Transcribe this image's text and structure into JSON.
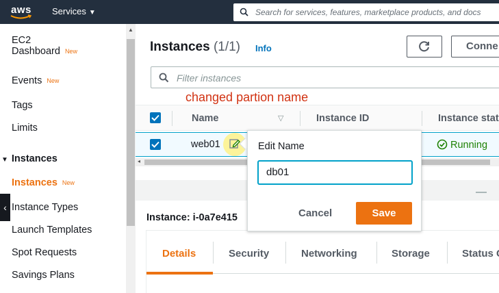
{
  "topbar": {
    "logo_text": "aws",
    "services_label": "Services",
    "search_placeholder": "Search for services, features, marketplace products, and docs"
  },
  "sidebar": {
    "ec2_label": "EC2",
    "dashboard_label": "Dashboard",
    "new_badge": "New",
    "events_label": "Events",
    "tags_label": "Tags",
    "limits_label": "Limits",
    "instances_section": "Instances",
    "instances_label": "Instances",
    "instance_types_label": "Instance Types",
    "launch_templates_label": "Launch Templates",
    "spot_requests_label": "Spot Requests",
    "savings_plans_label": "Savings Plans"
  },
  "header": {
    "title": "Instances",
    "count": "(1/1)",
    "info_link": "Info",
    "connect_label": "Conne"
  },
  "filter": {
    "placeholder": "Filter instances"
  },
  "annotation": "changed partion name",
  "table": {
    "columns": [
      "Name",
      "Instance ID",
      "Instance stat"
    ],
    "row": {
      "name": "web01",
      "status": "Running"
    }
  },
  "popover": {
    "title": "Edit Name",
    "input_value": "db01",
    "cancel_label": "Cancel",
    "save_label": "Save"
  },
  "details": {
    "instance_title": "Instance: i-0a7e415",
    "tabs": [
      "Details",
      "Security",
      "Networking",
      "Storage",
      "Status C"
    ]
  },
  "colors": {
    "nav_bg": "#232f3e",
    "accent": "#ec7211",
    "link": "#0073bb",
    "running": "#1d8102",
    "annotation": "#d13212"
  }
}
